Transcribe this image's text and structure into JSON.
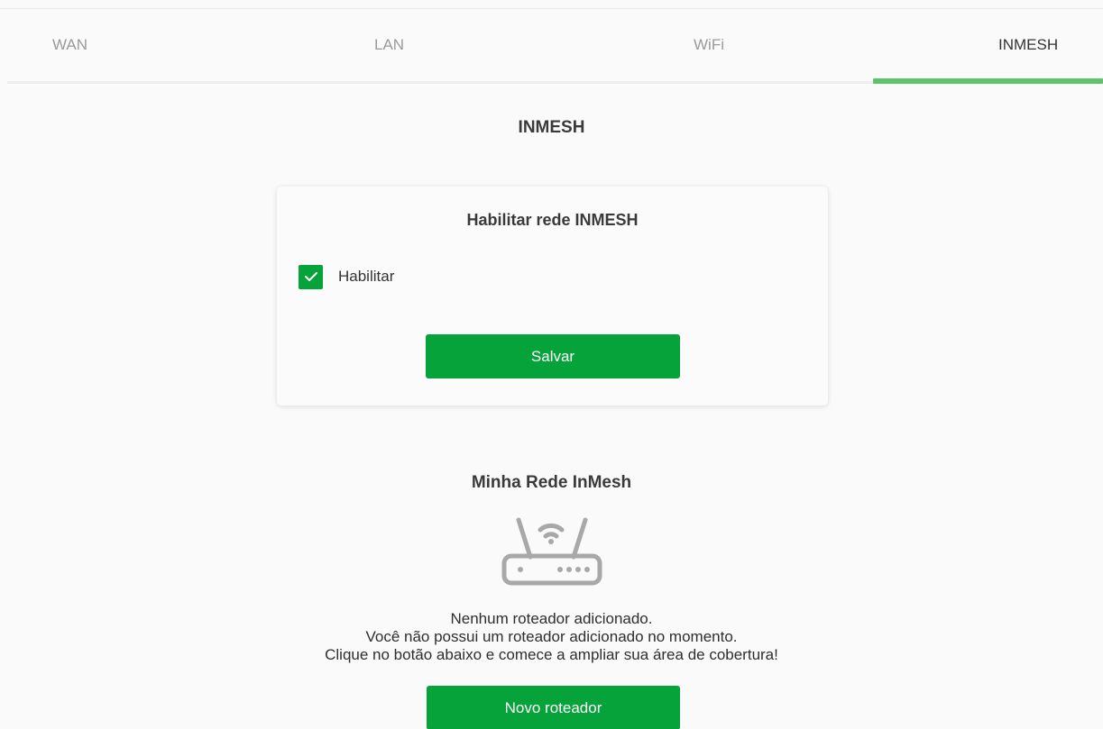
{
  "tabs": [
    {
      "label": "WAN",
      "active": false
    },
    {
      "label": "LAN",
      "active": false
    },
    {
      "label": "WiFi",
      "active": false
    },
    {
      "label": "INMESH",
      "active": true
    }
  ],
  "page_title": "INMESH",
  "enable_card": {
    "title": "Habilitar rede INMESH",
    "checkbox_label": "Habilitar",
    "checked": true,
    "save_label": "Salvar"
  },
  "my_network": {
    "title": "Minha Rede InMesh",
    "icon": "router-icon",
    "message_lines": [
      "Nenhum roteador adicionado.",
      "Você não possui um roteador adicionado no momento.",
      "Clique no botão abaixo e comece a ampliar sua área de cobertura!"
    ],
    "new_router_label": "Novo roteador"
  },
  "colors": {
    "accent_green": "#06a23a",
    "tab_underline": "#5cc46a",
    "background": "#fafafa"
  }
}
